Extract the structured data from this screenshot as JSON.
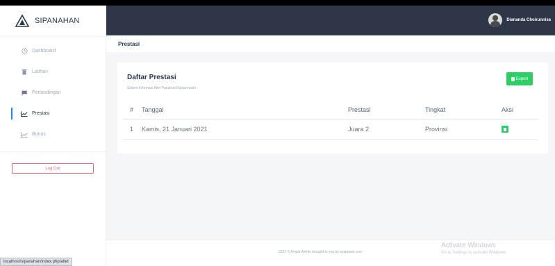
{
  "app": {
    "brand": "SIPANAHAN"
  },
  "sidebar": {
    "items": [
      {
        "label": "Dashboard",
        "icon": "clock-icon",
        "active": false
      },
      {
        "label": "Latihan",
        "icon": "trash-icon",
        "active": false
      },
      {
        "label": "Pertandingan",
        "icon": "flag-icon",
        "active": false
      },
      {
        "label": "Prestasi",
        "icon": "chart-line-icon",
        "active": true
      },
      {
        "label": "Bonus",
        "icon": "chart-line-icon",
        "active": false
      }
    ],
    "logout_label": "Log Out"
  },
  "topbar": {
    "user_name": "Diananda Choirunnisa"
  },
  "page": {
    "title": "Prestasi"
  },
  "card": {
    "title": "Daftar Prestasi",
    "subtitle": "Sistem Informasi Atlet Panahan Banjarmasin",
    "export_label": "Export",
    "table": {
      "headers": [
        "#",
        "Tanggal",
        "Prestasi",
        "Tingkat",
        "Aksi"
      ],
      "rows": [
        {
          "no": "1",
          "tanggal": "Kamis, 21 Januari 2021",
          "prestasi": "Juara 2",
          "tingkat": "Provinsi"
        }
      ]
    }
  },
  "footer": {
    "text": "2021 © Ample Admin brought to you by wrappixel.com"
  },
  "watermark": {
    "title": "Activate Windows",
    "subtitle": "Go to Settings to activate Windows."
  },
  "statusbar": {
    "url": "localhost/sipanahan/index.php/atlet"
  },
  "colors": {
    "accent": "#1e88e5",
    "topbar": "#2d3747",
    "success": "#2dce63",
    "danger": "#e46a76"
  }
}
